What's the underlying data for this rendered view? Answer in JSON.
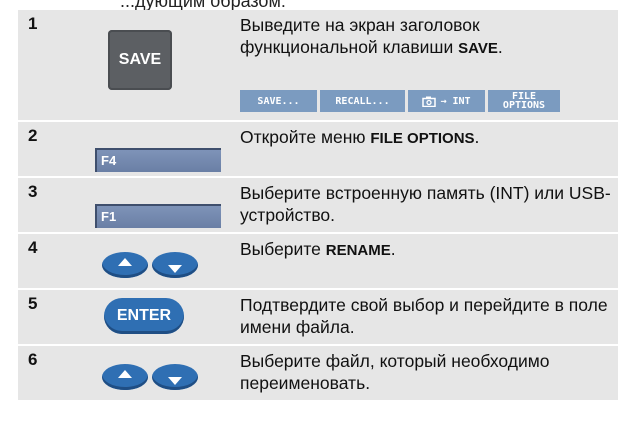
{
  "top_cut_text": "...дующим образом:",
  "rows": [
    {
      "num": "1",
      "key_label": "SAVE",
      "text_before": "Выведите на экран заголовок функциональной клавиши ",
      "text_bold": "SAVE",
      "text_after": "."
    },
    {
      "num": "2",
      "key_label": "F4",
      "text_before": "Откройте меню ",
      "text_bold": "FILE OPTIONS",
      "text_after": "."
    },
    {
      "num": "3",
      "key_label": "F1",
      "text": "Выберите встроенную память (INT) или USB-устройство."
    },
    {
      "num": "4",
      "text_before": "Выберите ",
      "text_bold": "RENAME",
      "text_after": "."
    },
    {
      "num": "5",
      "key_label": "ENTER",
      "text": "Подтвердите свой выбор и перейдите в поле имени файла."
    },
    {
      "num": "6",
      "text": "Выберите файл, который необходимо переименовать."
    }
  ],
  "menu": {
    "items": [
      "SAVE...",
      "RECALL...",
      "→ INT",
      "FILE",
      "OPTIONS"
    ]
  },
  "colors": {
    "row_bg": "#e6e6e6",
    "save_key": "#5c5f63",
    "fkey": "#7389ae",
    "blue_button": "#2f6fb3",
    "menu_cell": "#7b9bc0"
  }
}
